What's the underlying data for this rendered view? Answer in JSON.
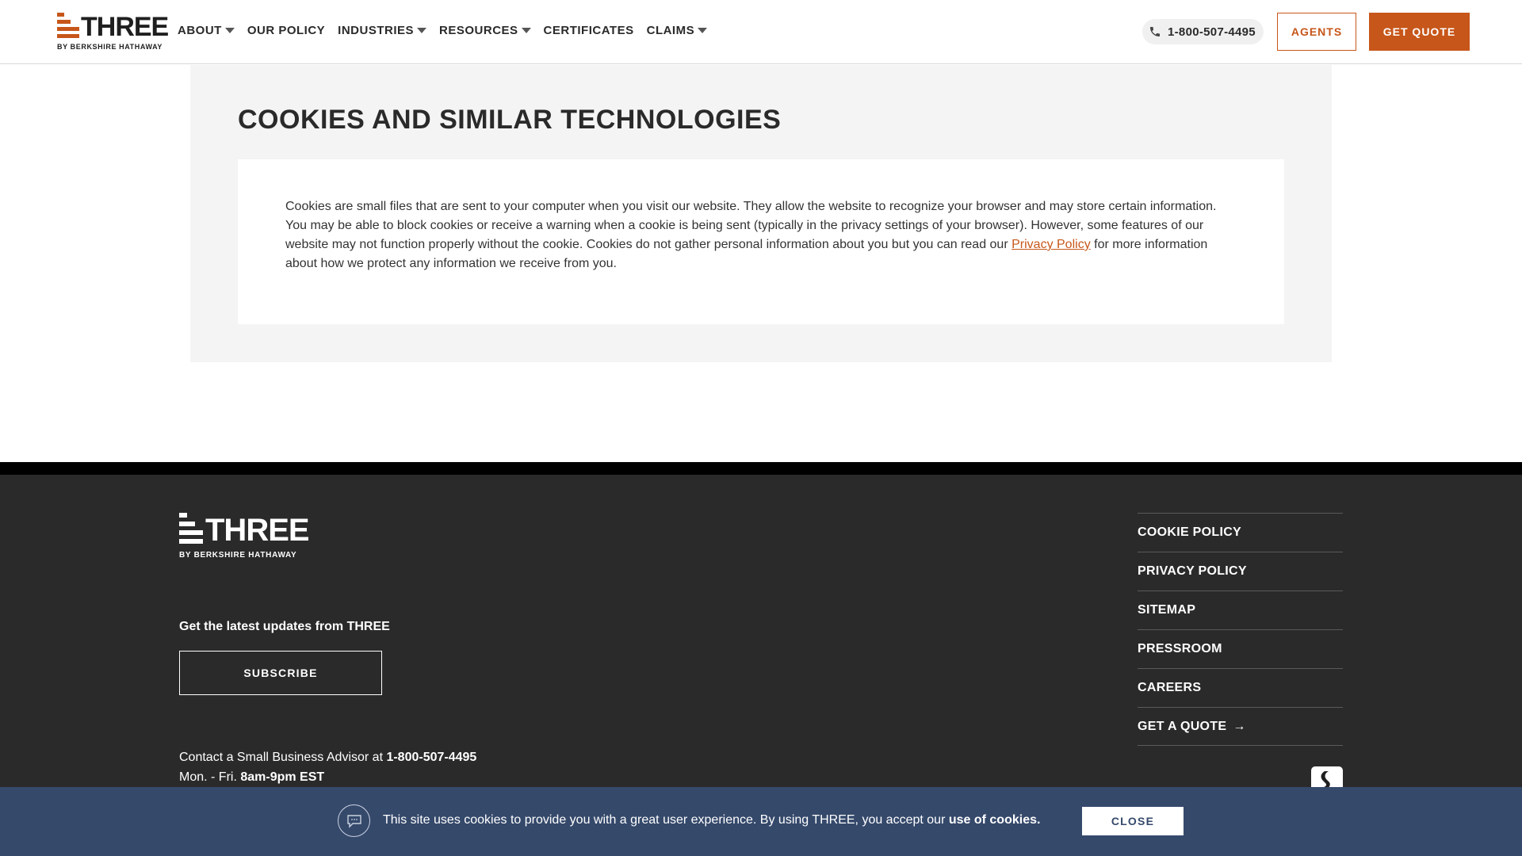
{
  "header": {
    "logo": {
      "word": "THREE",
      "sub": "BY BERKSHIRE HATHAWAY"
    },
    "nav": [
      {
        "label": "ABOUT",
        "dropdown": true
      },
      {
        "label": "OUR POLICY",
        "dropdown": false
      },
      {
        "label": "INDUSTRIES",
        "dropdown": true
      },
      {
        "label": "RESOURCES",
        "dropdown": true
      },
      {
        "label": "CERTIFICATES",
        "dropdown": false
      },
      {
        "label": "CLAIMS",
        "dropdown": true
      }
    ],
    "phone": "1-800-507-4495",
    "agents_label": "AGENTS",
    "quote_label": "GET QUOTE"
  },
  "main": {
    "title": "COOKIES AND SIMILAR TECHNOLOGIES",
    "body_before": "Cookies are small files that are sent to your computer when you visit our website. They allow the website to recognize your browser and may store certain information. You may be able to block cookies or receive a warning when a cookie is being sent (typically in the privacy settings of your browser). However, some features of our website may not function properly without the cookie. Cookies do not gather personal information about you but you can read our ",
    "body_link": "Privacy Policy",
    "body_after": " for more information about how we protect any information we receive from you."
  },
  "footer": {
    "logo": {
      "word": "THREE",
      "sub": "BY BERKSHIRE HATHAWAY"
    },
    "updates_text": "Get the latest updates from THREE",
    "subscribe_label": "SUBSCRIBE",
    "contact_prefix": "Contact a Small Business Advisor at ",
    "contact_phone": "1-800-507-4495",
    "hours_prefix": "Mon. - Fri. ",
    "hours": "8am-9pm EST",
    "links": [
      {
        "label": "COOKIE POLICY"
      },
      {
        "label": "PRIVACY POLICY"
      },
      {
        "label": "SITEMAP"
      },
      {
        "label": "PRESSROOM"
      },
      {
        "label": "CAREERS"
      },
      {
        "label": "GET A QUOTE",
        "arrow": "→"
      }
    ]
  },
  "cookie_banner": {
    "text": "This site uses cookies to provide you with a great user experience. By using THREE, you accept our ",
    "link_text": "use of cookies.",
    "close_label": "CLOSE"
  },
  "colors": {
    "brand_orange": "#c7561a",
    "footer_bg": "#2a2a2a",
    "banner_bg": "#35496b"
  }
}
